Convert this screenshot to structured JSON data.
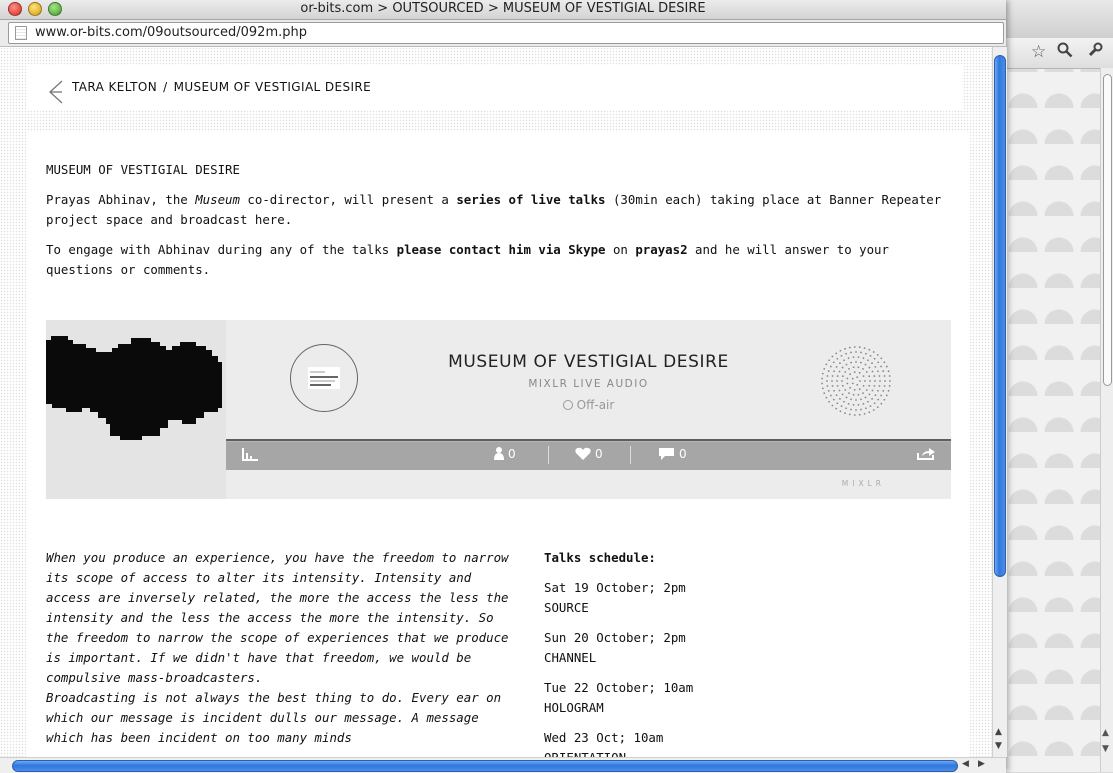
{
  "window": {
    "title": "or-bits.com > OUTSOURCED > MUSEUM OF VESTIGIAL DESIRE",
    "url": "www.or-bits.com/09outsourced/092m.php"
  },
  "breadcrumb": {
    "artist": "TARA KELTON",
    "separator": "/",
    "project": "MUSEUM OF VESTIGIAL DESIRE"
  },
  "intro": {
    "heading": "MUSEUM OF VESTIGIAL DESIRE",
    "p1_a": "Prayas Abhinav, the ",
    "p1_em": "Museum",
    "p1_b": " co-director, will present a ",
    "p1_strong": "series of live talks",
    "p1_c": " (30min each) taking place at Banner Repeater project space and broadcast here.",
    "p2_a": "To engage with Abhinav during any of the talks ",
    "p2_strong": "please contact him via Skype",
    "p2_b": " on ",
    "p2_skype": "prayas2",
    "p2_c": " and he will answer to your questions or comments."
  },
  "player": {
    "title": "MUSEUM OF VESTIGIAL DESIRE",
    "subtitle": "MIXLR LIVE AUDIO",
    "status": "Off-air",
    "listeners": "0",
    "hearts": "0",
    "comments": "0",
    "brand": "MIXLR"
  },
  "quote": {
    "p1": "When you produce an experience, you have the freedom to narrow its scope of access to alter its intensity. Intensity and access are inversely related, the more the access the less the intensity and the less the access the more the intensity. So the freedom to narrow the scope of experiences that we produce is important. If we didn't have that freedom, we would be compulsive mass-broadcasters.",
    "p2": "Broadcasting is not always the best thing to do. Every ear on which our message is incident dulls our message. A message which has been incident on too many minds"
  },
  "schedule": {
    "heading": "Talks schedule:",
    "items": [
      {
        "date": "Sat 19 October; 2pm",
        "name": "SOURCE"
      },
      {
        "date": "Sun 20 October; 2pm",
        "name": "CHANNEL"
      },
      {
        "date": "Tue 22 October; 10am",
        "name": "HOLOGRAM"
      },
      {
        "date": "Wed 23 Oct; 10am",
        "name": "ORIENTATION"
      }
    ]
  },
  "colors": {
    "scroll_accent": "#2f77df",
    "player_bg": "#ececec",
    "player_bar": "#a6a6a6"
  }
}
